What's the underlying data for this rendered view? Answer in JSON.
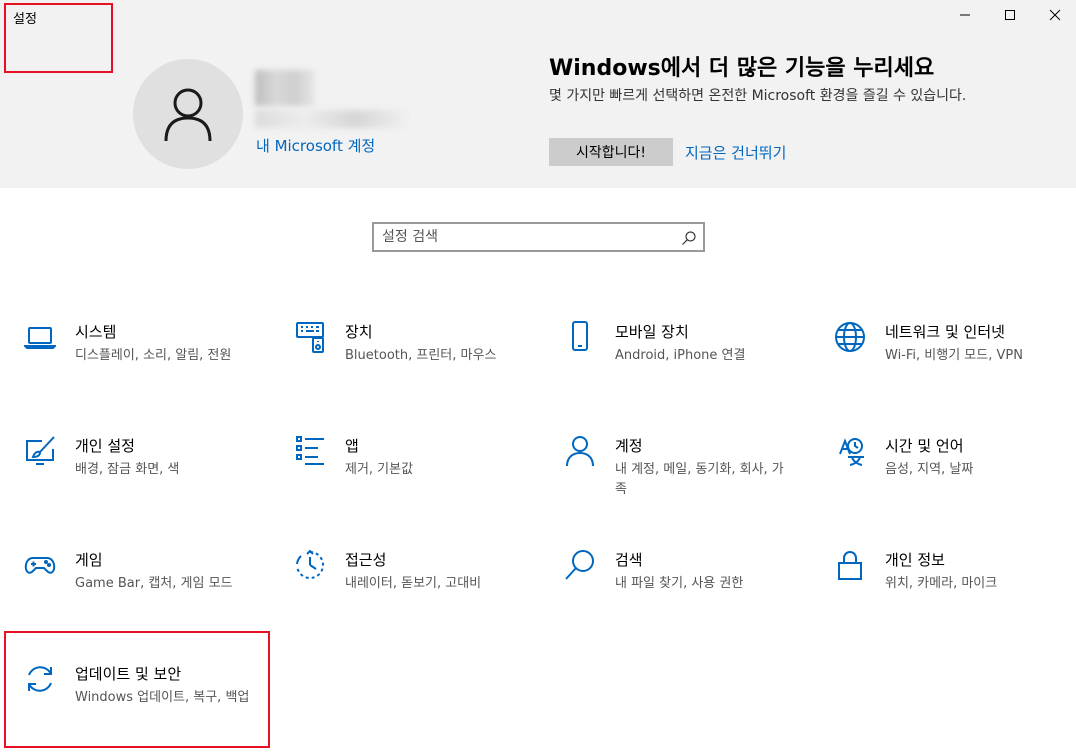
{
  "window": {
    "title": "설정",
    "controls": {
      "minimize": "minimize-icon",
      "maximize": "maximize-icon",
      "close": "close-icon"
    }
  },
  "account": {
    "link": "내 Microsoft 계정",
    "avatar_icon": "person-icon"
  },
  "promo": {
    "title": "Windows에서 더 많은 기능을 누리세요",
    "description": "몇 가지만 빠르게 선택하면 온전한 Microsoft 환경을 즐길 수 있습니다.",
    "start_button": "시작합니다!",
    "skip_link": "지금은 건너뛰기"
  },
  "search": {
    "placeholder": "설정 검색",
    "icon": "search-icon"
  },
  "categories": [
    {
      "title": "시스템",
      "desc": "디스플레이, 소리, 알림, 전원",
      "icon": "laptop-icon"
    },
    {
      "title": "장치",
      "desc": "Bluetooth, 프린터, 마우스",
      "icon": "devices-icon"
    },
    {
      "title": "모바일 장치",
      "desc": "Android, iPhone 연결",
      "icon": "phone-icon"
    },
    {
      "title": "네트워크 및 인터넷",
      "desc": "Wi-Fi, 비행기 모드, VPN",
      "icon": "globe-icon"
    },
    {
      "title": "개인 설정",
      "desc": "배경, 잠금 화면, 색",
      "icon": "personalization-icon"
    },
    {
      "title": "앱",
      "desc": "제거, 기본값",
      "icon": "apps-list-icon"
    },
    {
      "title": "계정",
      "desc": "내 계정, 메일, 동기화, 회사, 가족",
      "icon": "account-icon"
    },
    {
      "title": "시간 및 언어",
      "desc": "음성, 지역, 날짜",
      "icon": "time-language-icon"
    },
    {
      "title": "게임",
      "desc": "Game Bar, 캡처, 게임 모드",
      "icon": "gamepad-icon"
    },
    {
      "title": "접근성",
      "desc": "내레이터, 돋보기, 고대비",
      "icon": "accessibility-icon"
    },
    {
      "title": "검색",
      "desc": "내 파일 찾기, 사용 권한",
      "icon": "search-category-icon"
    },
    {
      "title": "개인 정보",
      "desc": "위치, 카메라, 마이크",
      "icon": "lock-icon"
    },
    {
      "title": "업데이트 및 보안",
      "desc": "Windows 업데이트, 복구, 백업",
      "icon": "sync-icon"
    }
  ],
  "colors": {
    "accent": "#0067c0",
    "highlight": "#e81123",
    "header_bg": "#f2f2f2"
  }
}
